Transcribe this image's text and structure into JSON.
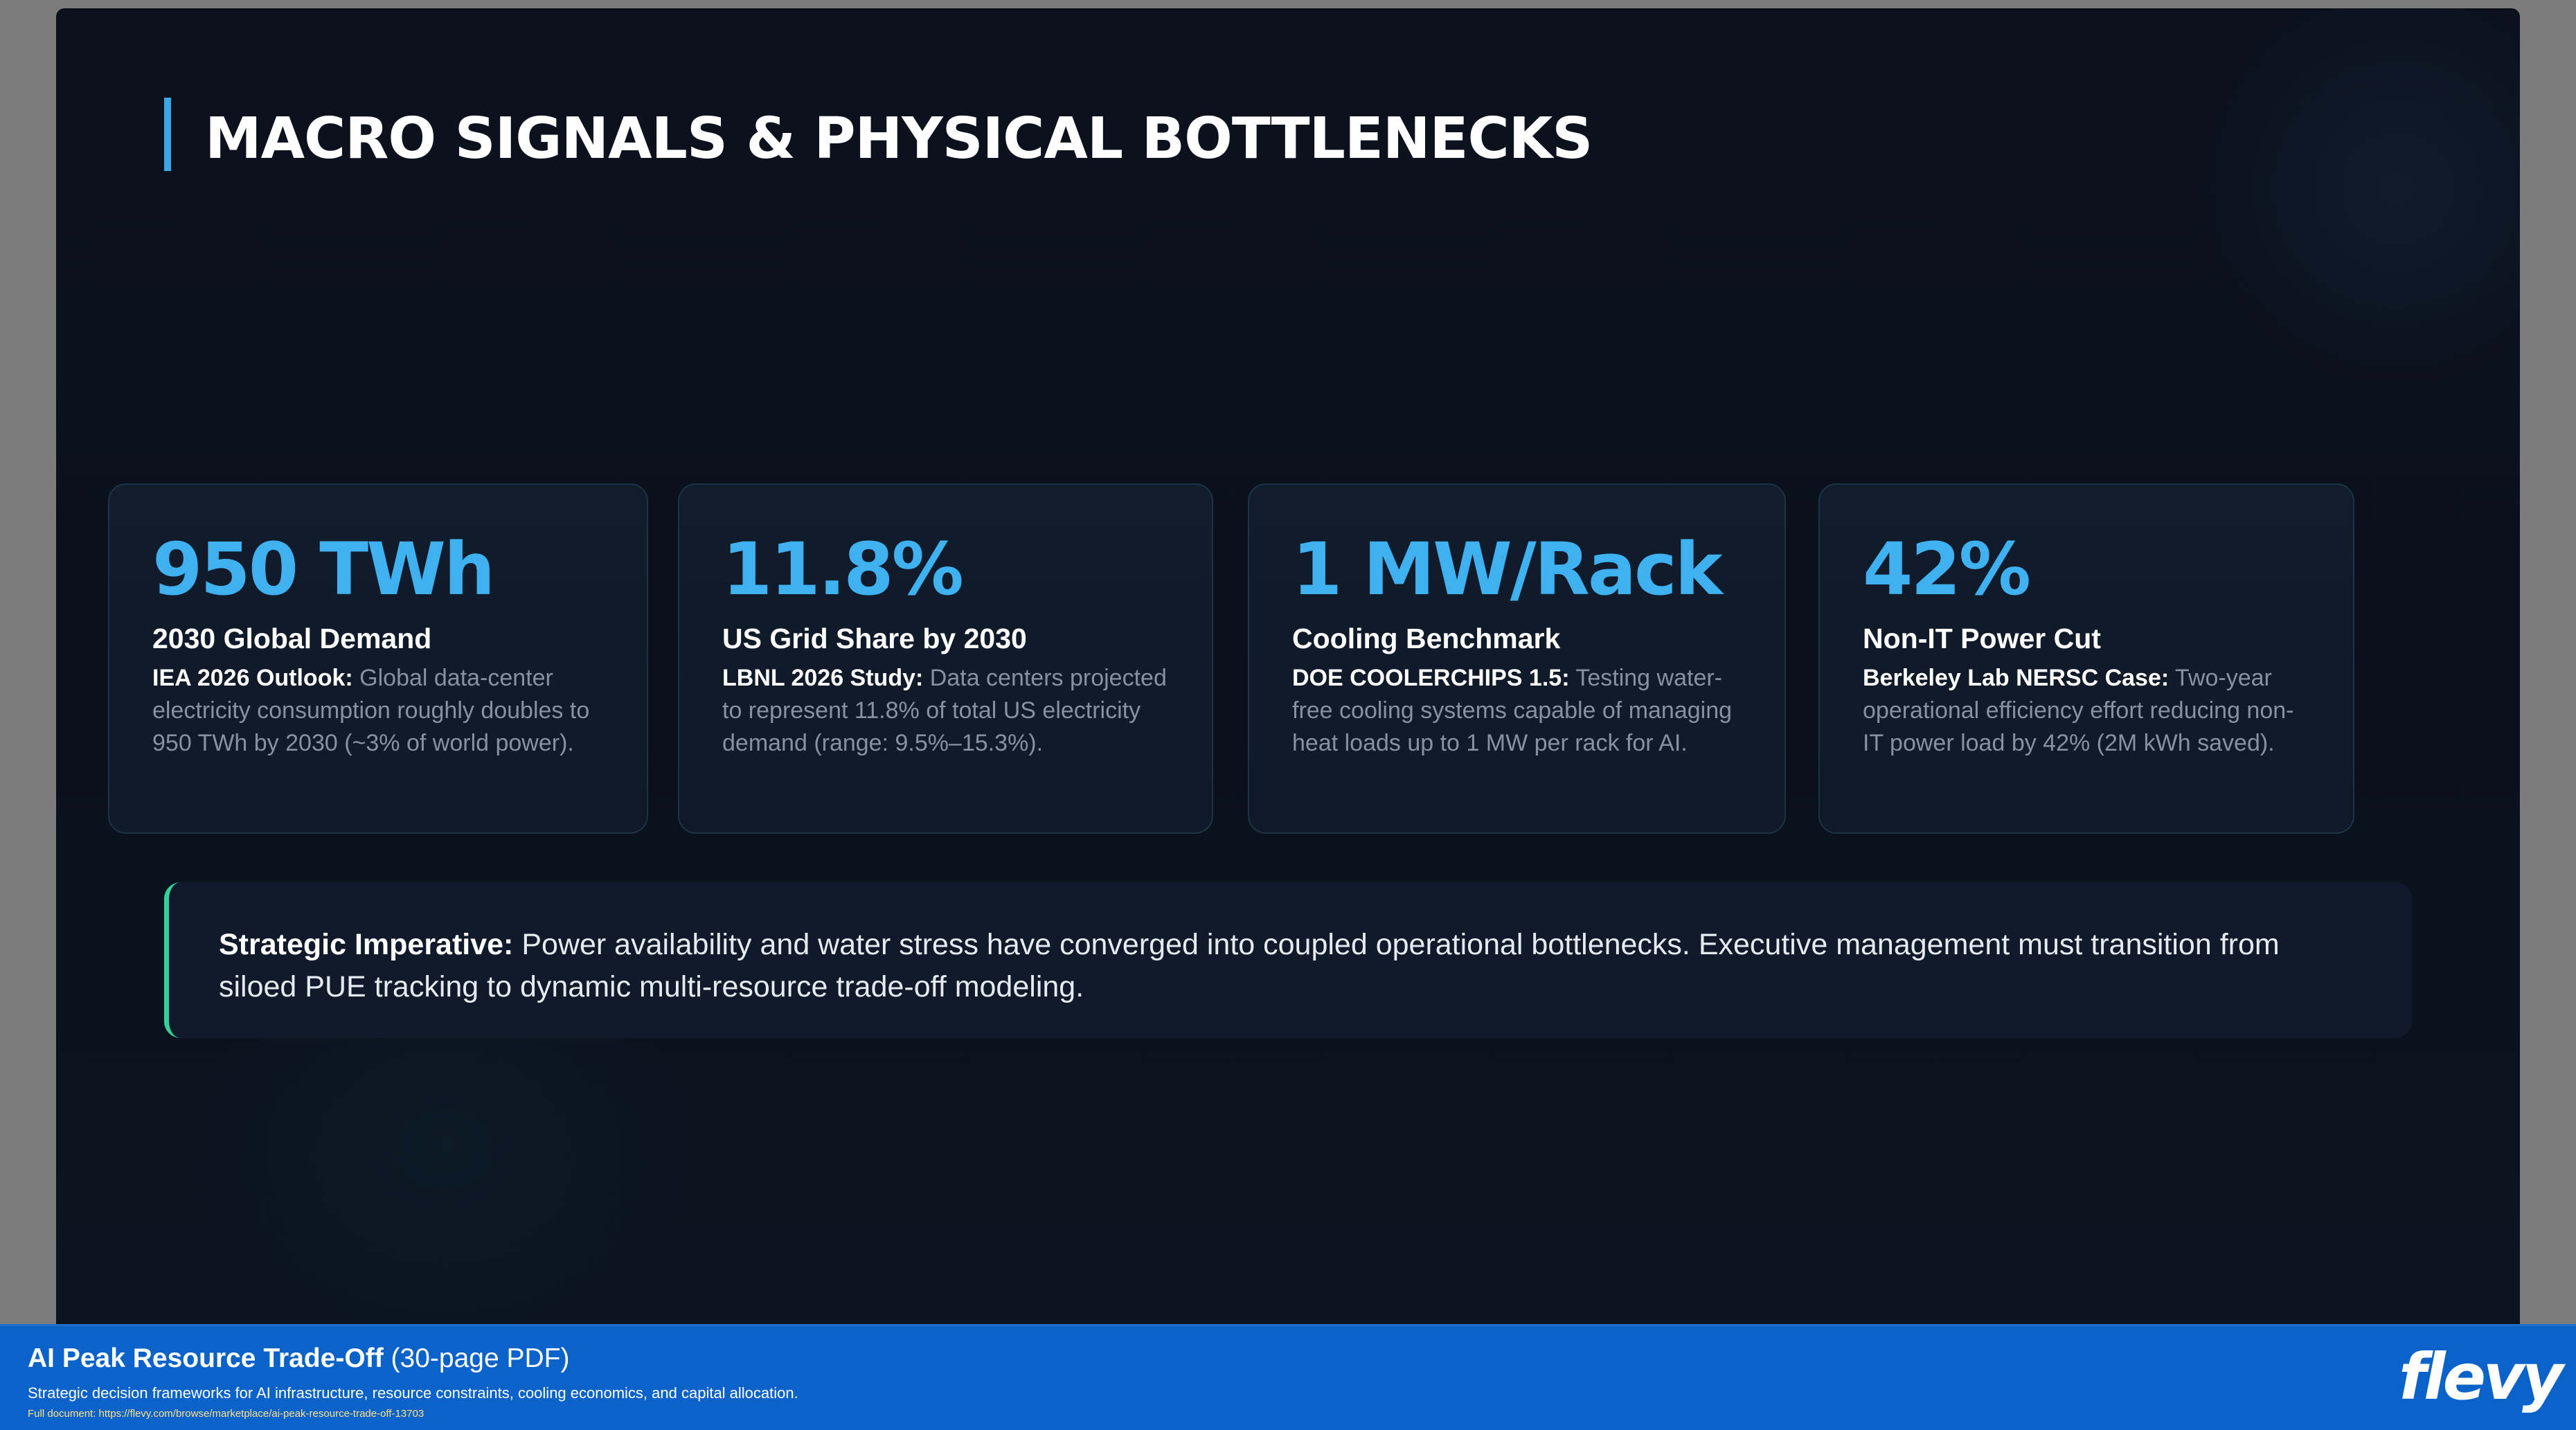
{
  "slide": {
    "title": "MACRO SIGNALS & PHYSICAL BOTTLENECKS",
    "accent_color": "#3ba7e8",
    "cards": [
      {
        "stat": "950 TWh",
        "label": "2030 Global Demand",
        "source": "IEA 2026 Outlook:",
        "text": "Global data-center electricity consumption roughly doubles to 950 TWh by 2030 (~3% of world power)."
      },
      {
        "stat": "11.8%",
        "label": "US Grid Share by 2030",
        "source": "LBNL 2026 Study:",
        "text": "Data centers projected to represent 11.8% of total US electricity demand (range: 9.5%–15.3%)."
      },
      {
        "stat": "1 MW/Rack",
        "label": "Cooling Benchmark",
        "source": "DOE COOLERCHIPS 1.5:",
        "text": "Testing water-free cooling systems capable of managing heat loads up to 1 MW per rack for AI."
      },
      {
        "stat": "42%",
        "label": "Non-IT Power Cut",
        "source": "Berkeley Lab NERSC Case:",
        "text": "Two-year operational efficiency effort reducing non-IT power load by 42% (2M kWh saved)."
      }
    ],
    "callout": {
      "lead": "Strategic Imperative:",
      "text": "Power availability and water stress have converged into coupled operational bottlenecks. Executive management must transition from siloed PUE tracking to dynamic multi-resource trade-off modeling.",
      "border_color": "#33d29a"
    }
  },
  "footer": {
    "title": "AI Peak Resource Trade-Off",
    "pages": "(30-page PDF)",
    "subtitle": "Strategic decision frameworks for AI infrastructure, resource constraints, cooling economics, and capital allocation.",
    "url_text": "Full document: https://flevy.com/browse/marketplace/ai-peak-resource-trade-off-13703",
    "logo": "flevy",
    "background_color": "#0b63c9"
  }
}
